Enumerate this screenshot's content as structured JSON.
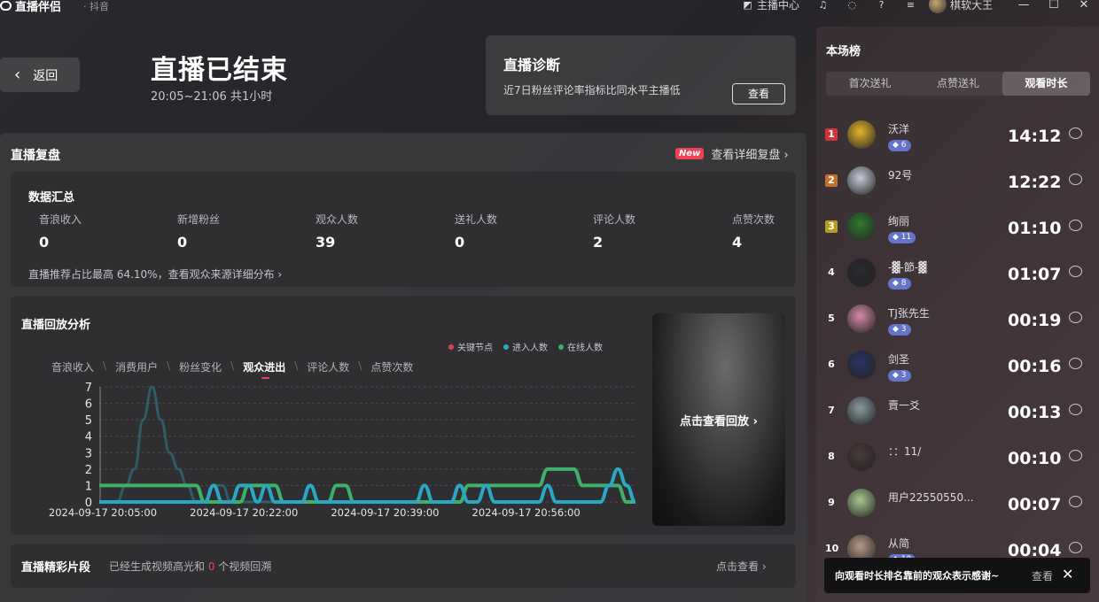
{
  "app": {
    "name": "直播伴侣",
    "sub": "· 抖音"
  },
  "titlebar": {
    "center_label": "主播中心",
    "username": "棋软大王"
  },
  "header": {
    "back_label": "返回",
    "title": "直播已结束",
    "time": "20:05~21:06 共1小时"
  },
  "diagnosis": {
    "title": "直播诊断",
    "desc": "近7日粉丝评论率指标比同水平主播低",
    "button": "查看"
  },
  "review": {
    "title": "直播复盘",
    "new_badge": "New",
    "detail_link": "查看详细复盘 ›"
  },
  "stats": {
    "title": "数据汇总",
    "items": [
      {
        "label": "音浪收入",
        "value": "0"
      },
      {
        "label": "新增粉丝",
        "value": "0"
      },
      {
        "label": "观众人数",
        "value": "39"
      },
      {
        "label": "送礼人数",
        "value": "0"
      },
      {
        "label": "评论人数",
        "value": "2"
      },
      {
        "label": "点赞次数",
        "value": "4"
      }
    ],
    "footer": "直播推荐占比最高 64.10%，查看观众来源详细分布 ›"
  },
  "chart": {
    "title": "直播回放分析",
    "legend": [
      "关键节点",
      "进入人数",
      "在线人数"
    ],
    "tabs": [
      "音浪收入",
      "消费用户",
      "粉丝变化",
      "观众进出",
      "评论人数",
      "点赞次数"
    ],
    "active_tab": "观众进出",
    "replay_label": "点击查看回放 ›"
  },
  "chart_data": {
    "type": "line",
    "title": "",
    "xlabel": "",
    "ylabel": "",
    "ylim": [
      0,
      7
    ],
    "yticks": [
      0,
      1,
      2,
      3,
      4,
      5,
      6,
      7
    ],
    "xtick_labels": [
      "2024-09-17 20:05:00",
      "2024-09-17 20:22:00",
      "2024-09-17 20:39:00",
      "2024-09-17 20:56:00"
    ],
    "x_start_min": 0,
    "x_end_min": 61,
    "series": [
      {
        "name": "进入人数",
        "color": "#2aa7c4",
        "x": [
          0,
          1,
          2,
          3,
          4,
          5,
          6,
          7,
          8,
          9,
          10,
          11,
          12,
          13,
          14,
          15,
          16,
          17,
          18,
          19,
          20,
          21,
          22,
          23,
          24,
          25,
          26,
          27,
          28,
          29,
          30,
          31,
          32,
          33,
          34,
          35,
          36,
          37,
          38,
          39,
          40,
          41,
          42,
          43,
          44,
          45,
          46,
          47,
          48,
          49,
          50,
          51,
          52,
          53,
          54,
          55,
          56,
          57,
          58,
          59,
          60,
          61
        ],
        "y": [
          0,
          0,
          0,
          0,
          0,
          0,
          0,
          0,
          0,
          0,
          0,
          0,
          0,
          1,
          0,
          0,
          1,
          1,
          0,
          1,
          0,
          0,
          0,
          0,
          1,
          0,
          0,
          0,
          0,
          0,
          0,
          0,
          0,
          0,
          0,
          0,
          0,
          1,
          0,
          0,
          0,
          1,
          0,
          0,
          1,
          0,
          0,
          0,
          0,
          0,
          0,
          1,
          0,
          0,
          0,
          0,
          0,
          0,
          1,
          2,
          1,
          0
        ]
      },
      {
        "name": "在线人数",
        "color": "#3fb06a",
        "x": [
          0,
          1,
          2,
          3,
          4,
          5,
          6,
          7,
          8,
          9,
          10,
          11,
          12,
          13,
          14,
          15,
          16,
          17,
          18,
          19,
          20,
          21,
          22,
          23,
          24,
          25,
          26,
          27,
          28,
          29,
          30,
          31,
          32,
          33,
          34,
          35,
          36,
          37,
          38,
          39,
          40,
          41,
          42,
          43,
          44,
          45,
          46,
          47,
          48,
          49,
          50,
          51,
          52,
          53,
          54,
          55,
          56,
          57,
          58,
          59,
          60,
          61
        ],
        "y": [
          1,
          1,
          1,
          1,
          1,
          1,
          1,
          1,
          1,
          1,
          1,
          1,
          0,
          0,
          0,
          0,
          0,
          1,
          1,
          1,
          1,
          0,
          0,
          0,
          0,
          0,
          0,
          1,
          1,
          0,
          0,
          0,
          0,
          0,
          0,
          0,
          0,
          0,
          0,
          0,
          0,
          0,
          1,
          1,
          1,
          1,
          1,
          1,
          1,
          1,
          1,
          2,
          2,
          2,
          2,
          1,
          1,
          1,
          1,
          1,
          0,
          0
        ]
      },
      {
        "name": "关键节点",
        "color": "#2f6f7a",
        "x": [
          0,
          1,
          2,
          3,
          4,
          5,
          6,
          7,
          8,
          9,
          10,
          11,
          12,
          13,
          14,
          15,
          16,
          17,
          18,
          19,
          20
        ],
        "y": [
          0,
          0,
          0,
          1,
          2,
          5,
          7,
          5,
          3,
          2,
          1,
          0,
          0,
          1,
          1,
          0,
          0,
          0,
          0,
          0,
          0
        ]
      }
    ]
  },
  "clips": {
    "title": "直播精彩片段",
    "desc_prefix": "已经生成视频高光和 ",
    "desc_count": "0",
    "desc_suffix": " 个视频回溯",
    "link": "点击查看 ›"
  },
  "ranking": {
    "title": "本场榜",
    "tabs": [
      "首次送礼",
      "点赞送礼",
      "观看时长"
    ],
    "active_tab": "观看时长",
    "rows": [
      {
        "rank": "1",
        "name": "沃洋",
        "badge": "6",
        "time": "14:12",
        "rank_color": "#d2363c",
        "avatar": "#e6b52a"
      },
      {
        "rank": "2",
        "name": "92号",
        "badge": "",
        "time": "12:22",
        "rank_color": "#c6702b",
        "avatar": "#c5cbd8"
      },
      {
        "rank": "3",
        "name": "绚丽",
        "badge": "11",
        "time": "01:10",
        "rank_color": "#b79b21",
        "avatar": "#2f7a2f"
      },
      {
        "rank": "4",
        "name": "-▓-節-▓",
        "badge": "8",
        "time": "01:07",
        "rank_color": "",
        "avatar": "#2a2a30"
      },
      {
        "rank": "5",
        "name": "TJ张先生",
        "badge": "3",
        "time": "00:19",
        "rank_color": "",
        "avatar": "#d489a8"
      },
      {
        "rank": "6",
        "name": "剑圣",
        "badge": "3",
        "time": "00:16",
        "rank_color": "",
        "avatar": "#2a3566"
      },
      {
        "rank": "7",
        "name": "賣一爻",
        "badge": "",
        "time": "00:13",
        "rank_color": "",
        "avatar": "#8a9aa0"
      },
      {
        "rank": "8",
        "name": "：：11/",
        "badge": "",
        "time": "00:10",
        "rank_color": "",
        "avatar": "#4a3a3a"
      },
      {
        "rank": "9",
        "name": "用户22550550...",
        "badge": "",
        "time": "00:07",
        "rank_color": "",
        "avatar": "#a8c890"
      },
      {
        "rank": "10",
        "name": "从简",
        "badge": "10",
        "time": "00:04",
        "rank_color": "",
        "avatar": "#b89a88"
      }
    ]
  },
  "toast": {
    "text": "向观看时长排名靠前的观众表示感谢~",
    "view": "查看"
  }
}
